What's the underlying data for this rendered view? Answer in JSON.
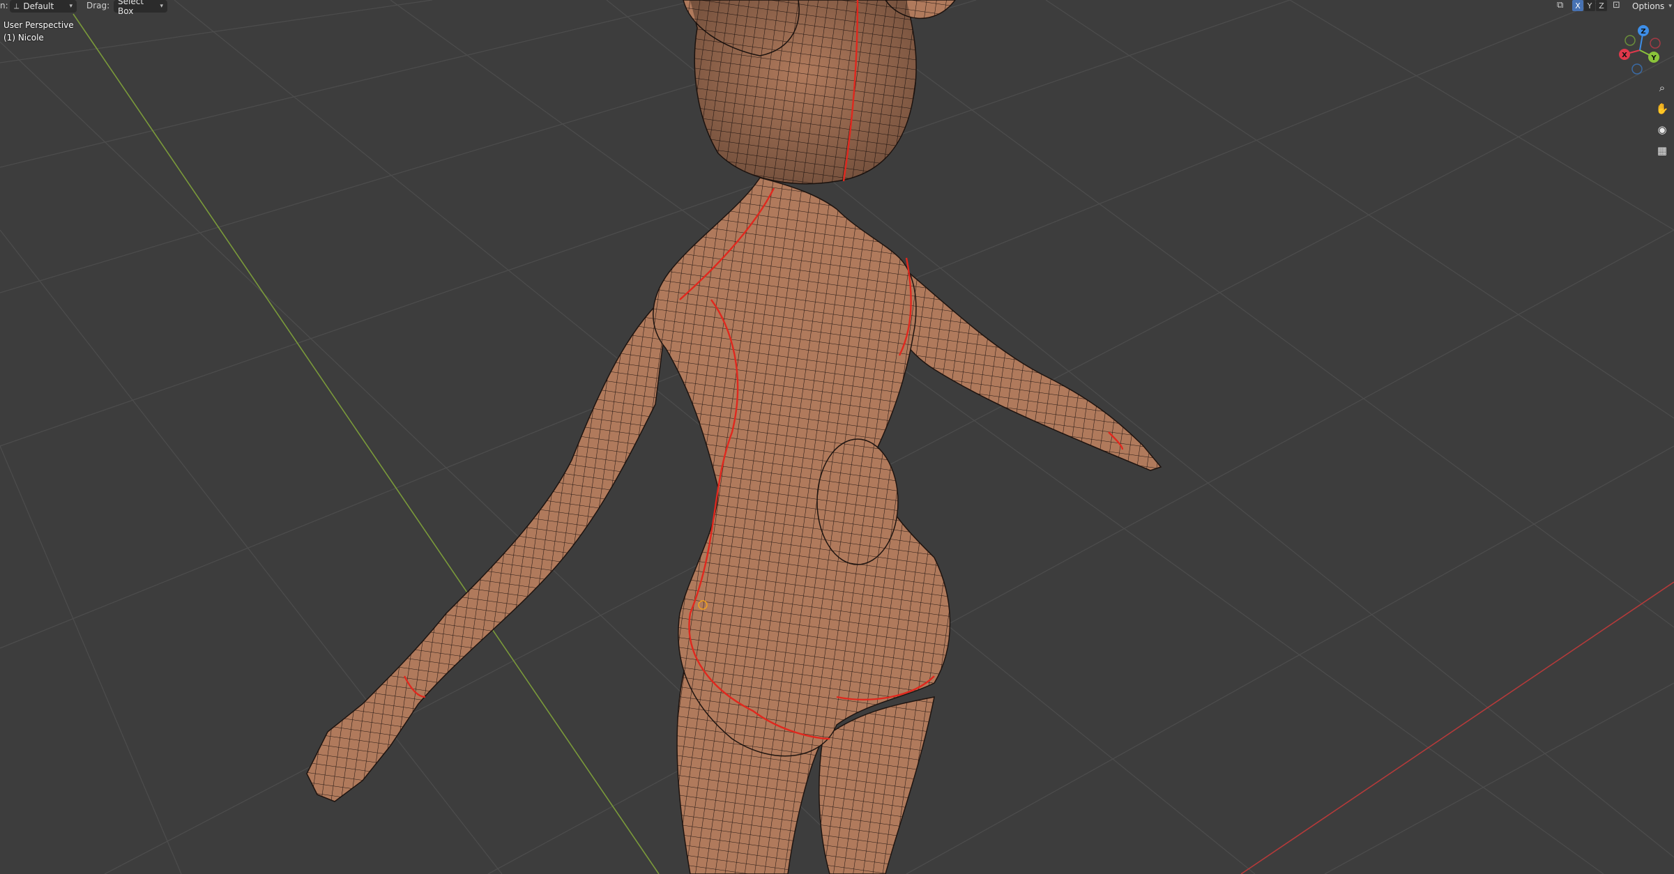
{
  "header": {
    "orientation_prefix": "n:",
    "orientation_value": "Default",
    "drag_label": "Drag:",
    "drag_value": "Select Box",
    "axis_toggles": [
      "X",
      "Y",
      "Z"
    ],
    "options_label": "Options"
  },
  "viewport": {
    "view_name": "User Perspective",
    "object_name": "(1) Nicole"
  },
  "gizmo": {
    "axis_labels": {
      "x": "X",
      "y": "Y",
      "z": "Z"
    },
    "colors": {
      "x": "#e0384b",
      "y": "#8ac33a",
      "z": "#3d8ee8",
      "grid": "#4a4a4a",
      "x_axis_line": "#b53a3a",
      "y_axis_line": "#7a9a3a"
    }
  },
  "icons": {
    "orientation": "transform-orientation-icon",
    "zoom": "zoom-icon",
    "pan": "hand-pan-icon",
    "camera": "camera-icon",
    "ortho": "grid-ortho-icon",
    "mirror": "mirror-icon",
    "options_extra": "sync-icon"
  },
  "model": {
    "skin_color": "#b07a5c",
    "wire_color": "#1e1410",
    "seam_color": "#e0281e"
  }
}
